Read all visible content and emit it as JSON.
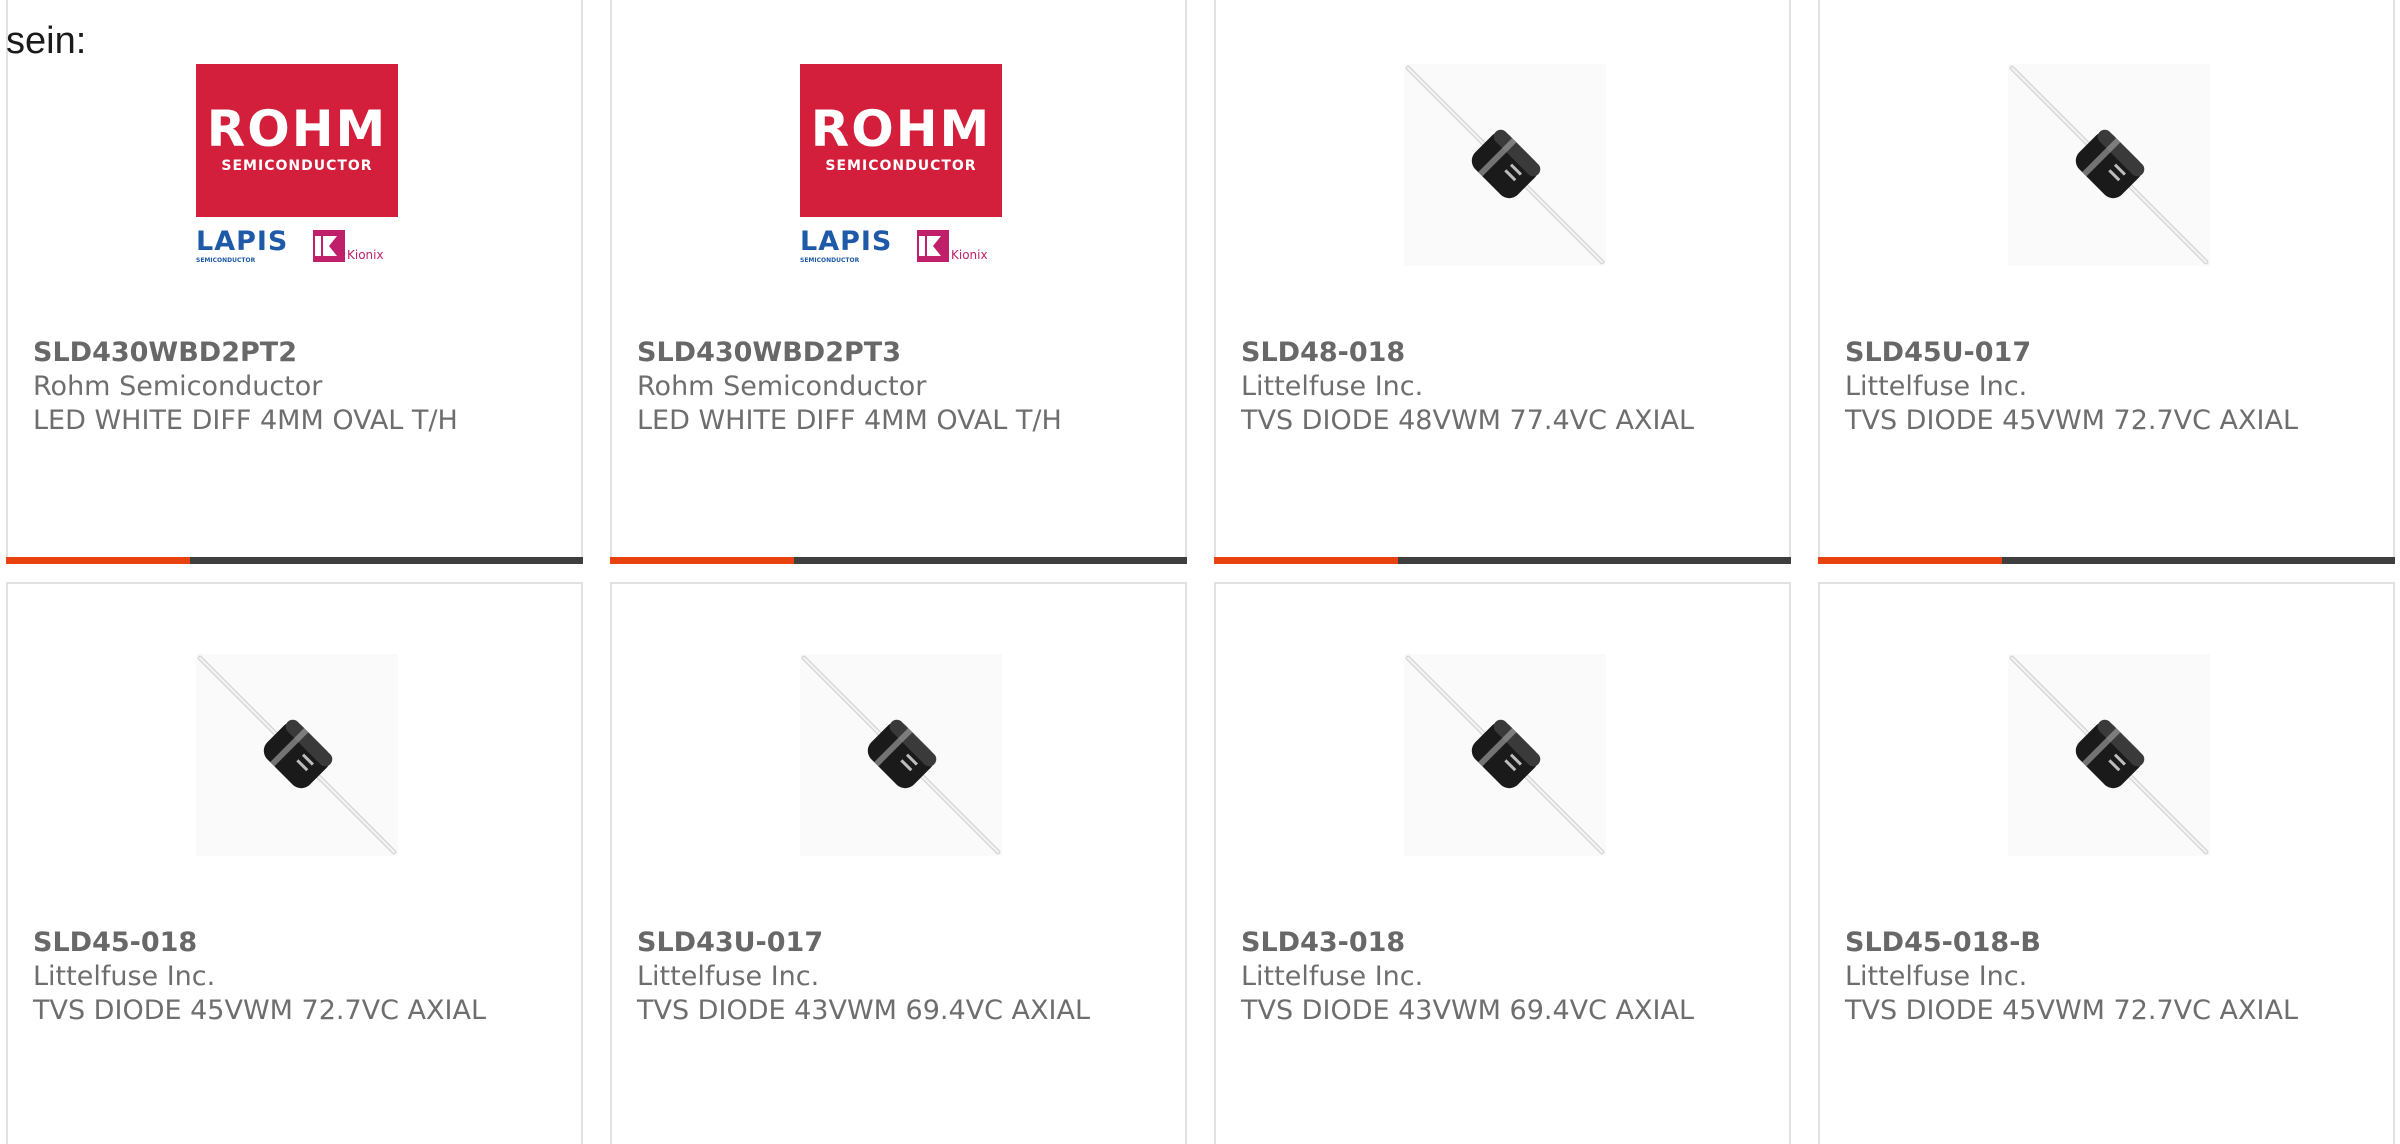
{
  "intro_text": "sein:",
  "colors": {
    "accent": "#e8430f",
    "bar": "#3f3f3f",
    "rohm_red": "#d41f3c",
    "lapis_blue": "#1e5aa8",
    "kionix_magenta": "#c0206a"
  },
  "logos": {
    "rohm_word": "ROHM",
    "rohm_sub": "SEMICONDUCTOR",
    "lapis_word": "LAPIS",
    "lapis_sub": "SEMICONDUCTOR",
    "kionix_word": "Kionix"
  },
  "products": [
    {
      "part_number": "SLD430WBD2PT2",
      "manufacturer": "Rohm Semiconductor",
      "description": "LED WHITE DIFF 4MM OVAL T/H",
      "image": "rohm-logo"
    },
    {
      "part_number": "SLD430WBD2PT3",
      "manufacturer": "Rohm Semiconductor",
      "description": "LED WHITE DIFF 4MM OVAL T/H",
      "image": "rohm-logo"
    },
    {
      "part_number": "SLD48-018",
      "manufacturer": "Littelfuse Inc.",
      "description": "TVS DIODE 48VWM 77.4VC AXIAL",
      "image": "axial-diode"
    },
    {
      "part_number": "SLD45U-017",
      "manufacturer": "Littelfuse Inc.",
      "description": "TVS DIODE 45VWM 72.7VC AXIAL",
      "image": "axial-diode"
    },
    {
      "part_number": "SLD45-018",
      "manufacturer": "Littelfuse Inc.",
      "description": "TVS DIODE 45VWM 72.7VC AXIAL",
      "image": "axial-diode"
    },
    {
      "part_number": "SLD43U-017",
      "manufacturer": "Littelfuse Inc.",
      "description": "TVS DIODE 43VWM 69.4VC AXIAL",
      "image": "axial-diode"
    },
    {
      "part_number": "SLD43-018",
      "manufacturer": "Littelfuse Inc.",
      "description": "TVS DIODE 43VWM 69.4VC AXIAL",
      "image": "axial-diode"
    },
    {
      "part_number": "SLD45-018-B",
      "manufacturer": "Littelfuse Inc.",
      "description": "TVS DIODE 45VWM 72.7VC AXIAL",
      "image": "axial-diode"
    }
  ]
}
